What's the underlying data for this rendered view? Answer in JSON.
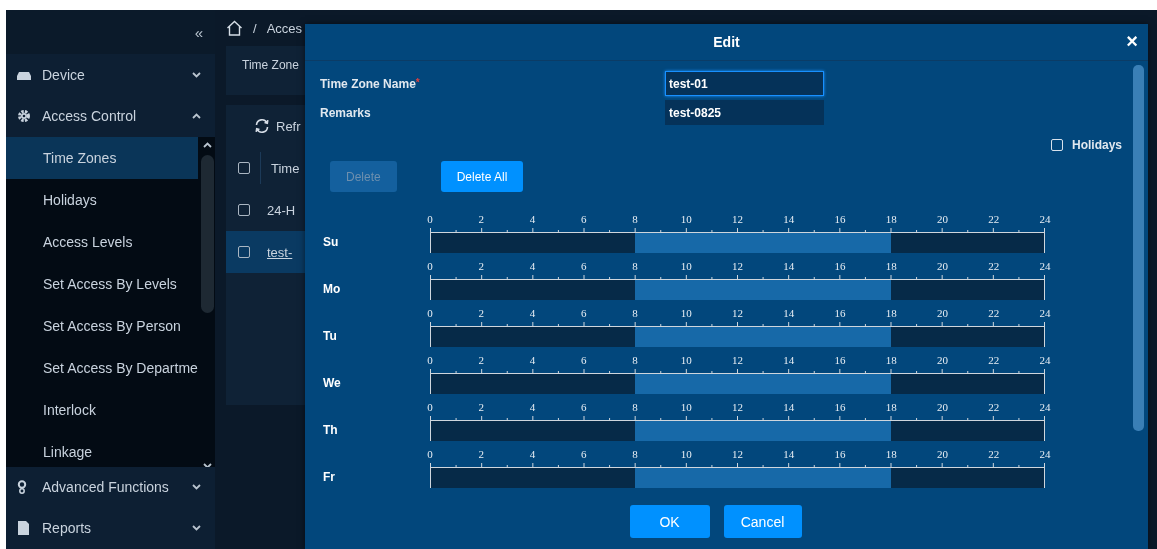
{
  "sidebar": {
    "collapse_glyph": "«",
    "groups": [
      {
        "label": "Device",
        "expanded": false
      },
      {
        "label": "Access Control",
        "expanded": true,
        "items": [
          {
            "label": "Time Zones",
            "selected": true
          },
          {
            "label": "Holidays",
            "selected": false
          },
          {
            "label": "Access Levels",
            "selected": false
          },
          {
            "label": "Set Access By Levels",
            "selected": false
          },
          {
            "label": "Set Access By Person",
            "selected": false
          },
          {
            "label": "Set Access By Departme",
            "selected": false
          },
          {
            "label": "Interlock",
            "selected": false
          },
          {
            "label": "Linkage",
            "selected": false
          }
        ]
      },
      {
        "label": "Advanced Functions",
        "expanded": false
      },
      {
        "label": "Reports",
        "expanded": false
      }
    ]
  },
  "breadcrumb": {
    "separator": "/",
    "current": "Acces"
  },
  "filter_panel": {
    "label": "Time Zone"
  },
  "toolbar": {
    "refresh": "Refr"
  },
  "table": {
    "header_checked": false,
    "columns": [
      "Time"
    ],
    "rows": [
      {
        "cells": [
          "24-H"
        ],
        "checked": false,
        "selected": false
      },
      {
        "cells": [
          "test-"
        ],
        "checked": false,
        "selected": true
      }
    ]
  },
  "dialog": {
    "title": "Edit",
    "close": "×",
    "fields": [
      {
        "label": "Time Zone Name",
        "required_mark": "*",
        "value": "test-01",
        "focused": true
      },
      {
        "label": "Remarks",
        "value": "test-0825",
        "focused": false
      }
    ],
    "holidays": {
      "label": "Holidays",
      "checked": false
    },
    "buttons": [
      {
        "label": "Delete",
        "disabled": true
      },
      {
        "label": "Delete All",
        "disabled": false
      }
    ],
    "days": [
      {
        "label": "Su",
        "ticks": [
          "0",
          "2",
          "4",
          "6",
          "8",
          "10",
          "12",
          "14",
          "16",
          "18",
          "20",
          "22",
          "24"
        ],
        "hours_active": [
          false,
          false,
          false,
          false,
          false,
          false,
          false,
          false,
          true,
          true,
          true,
          true,
          true,
          true,
          true,
          true,
          true,
          true,
          false,
          false,
          false,
          false,
          false,
          false
        ]
      },
      {
        "label": "Mo",
        "ticks": [
          "0",
          "2",
          "4",
          "6",
          "8",
          "10",
          "12",
          "14",
          "16",
          "18",
          "20",
          "22",
          "24"
        ],
        "hours_active": [
          false,
          false,
          false,
          false,
          false,
          false,
          false,
          false,
          true,
          true,
          true,
          true,
          true,
          true,
          true,
          true,
          true,
          true,
          false,
          false,
          false,
          false,
          false,
          false
        ]
      },
      {
        "label": "Tu",
        "ticks": [
          "0",
          "2",
          "4",
          "6",
          "8",
          "10",
          "12",
          "14",
          "16",
          "18",
          "20",
          "22",
          "24"
        ],
        "hours_active": [
          false,
          false,
          false,
          false,
          false,
          false,
          false,
          false,
          true,
          true,
          true,
          true,
          true,
          true,
          true,
          true,
          true,
          true,
          false,
          false,
          false,
          false,
          false,
          false
        ]
      },
      {
        "label": "We",
        "ticks": [
          "0",
          "2",
          "4",
          "6",
          "8",
          "10",
          "12",
          "14",
          "16",
          "18",
          "20",
          "22",
          "24"
        ],
        "hours_active": [
          false,
          false,
          false,
          false,
          false,
          false,
          false,
          false,
          true,
          true,
          true,
          true,
          true,
          true,
          true,
          true,
          true,
          true,
          false,
          false,
          false,
          false,
          false,
          false
        ]
      },
      {
        "label": "Th",
        "ticks": [
          "0",
          "2",
          "4",
          "6",
          "8",
          "10",
          "12",
          "14",
          "16",
          "18",
          "20",
          "22",
          "24"
        ],
        "hours_active": [
          false,
          false,
          false,
          false,
          false,
          false,
          false,
          false,
          true,
          true,
          true,
          true,
          true,
          true,
          true,
          true,
          true,
          true,
          false,
          false,
          false,
          false,
          false,
          false
        ]
      },
      {
        "label": "Fr",
        "ticks": [
          "0",
          "2",
          "4",
          "6",
          "8",
          "10",
          "12",
          "14",
          "16",
          "18",
          "20",
          "22",
          "24"
        ],
        "hours_active": [
          false,
          false,
          false,
          false,
          false,
          false,
          false,
          false,
          true,
          true,
          true,
          true,
          true,
          true,
          true,
          true,
          true,
          true,
          false,
          false,
          false,
          false,
          false,
          false
        ]
      }
    ],
    "footer_buttons": [
      "OK",
      "Cancel"
    ]
  }
}
